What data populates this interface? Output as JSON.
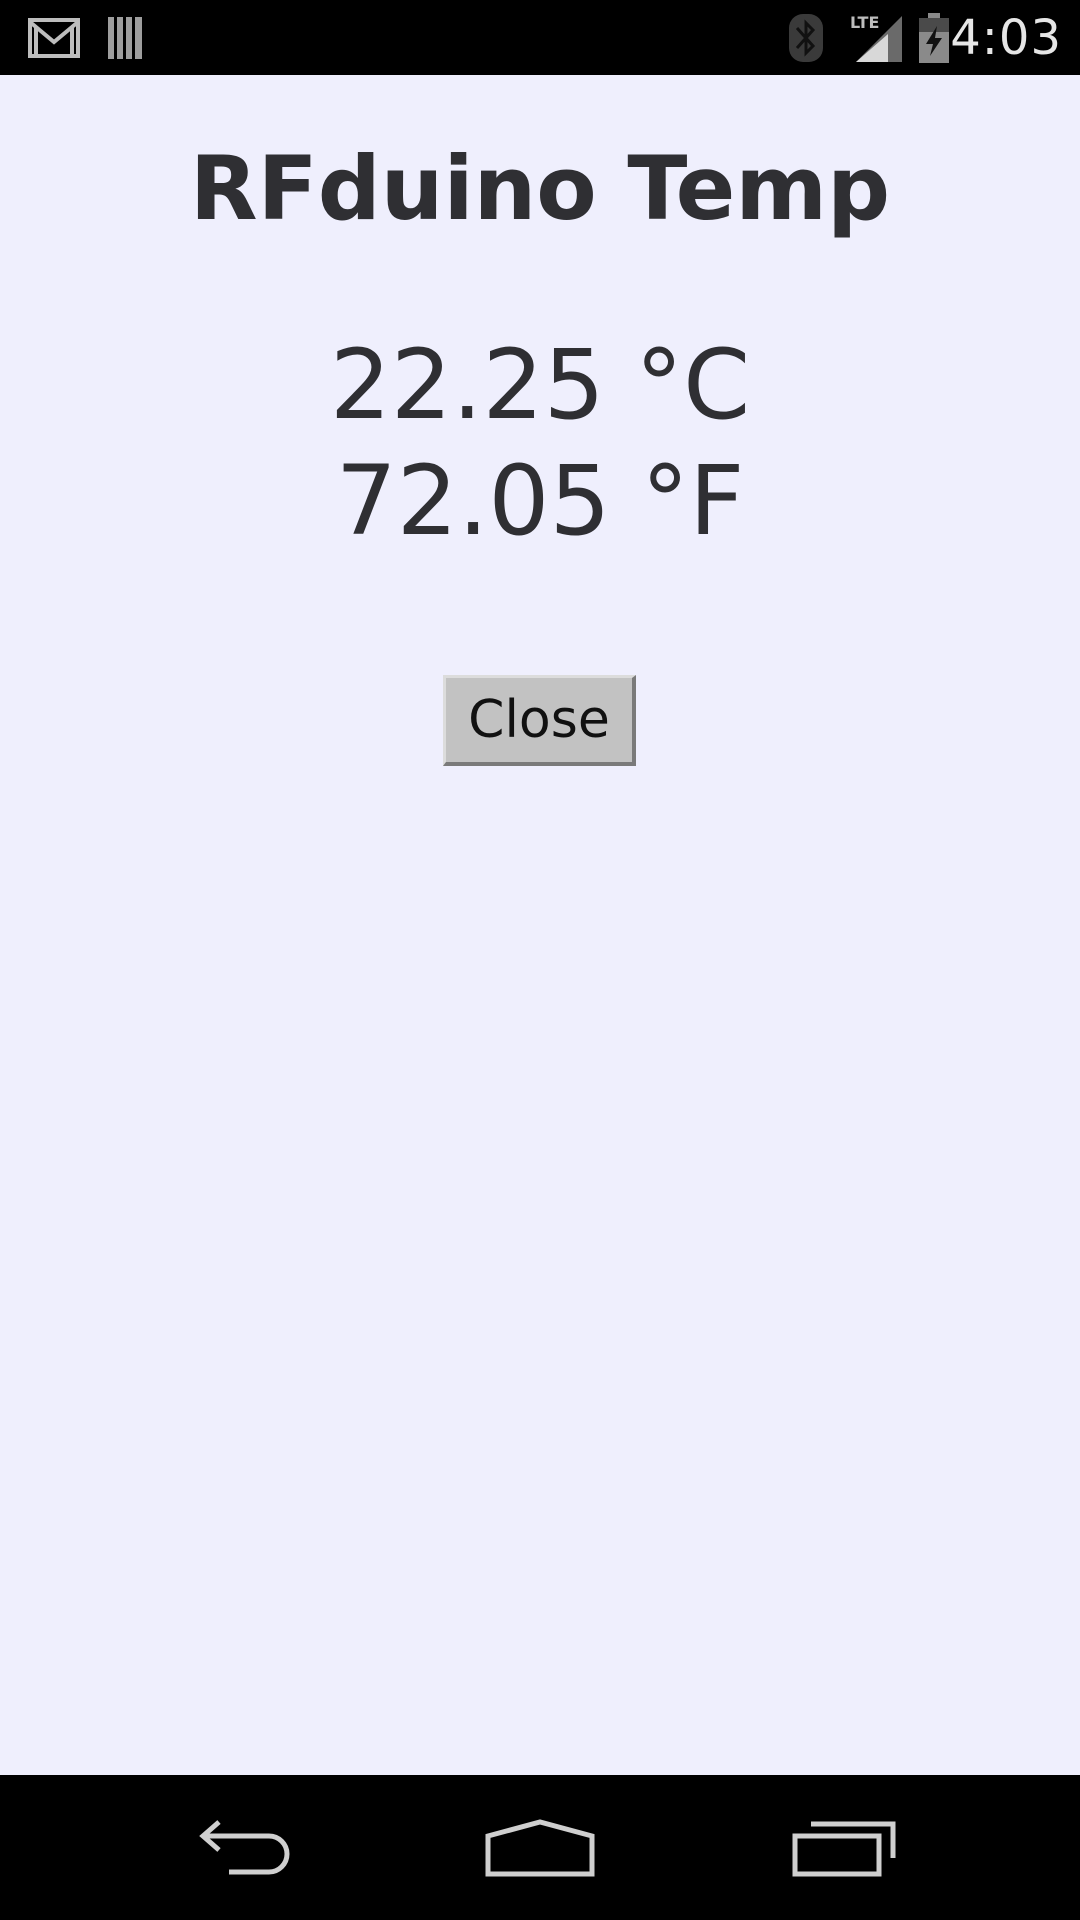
{
  "status_bar": {
    "time": "4:03",
    "network_label": "LTE",
    "icons": [
      "gmail-icon",
      "barcode-icon",
      "bluetooth-icon",
      "lte-signal-icon",
      "battery-charging-icon"
    ]
  },
  "app": {
    "title": "RFduino Temp",
    "celsius_reading": "22.25 °C",
    "fahrenheit_reading": "72.05 °F",
    "close_label": "Close"
  },
  "nav_bar": {
    "icons": [
      "back-icon",
      "home-icon",
      "recent-apps-icon"
    ]
  },
  "colors": {
    "background": "#efeffd",
    "text": "#2f2f33",
    "button": "#c2c2c2"
  }
}
